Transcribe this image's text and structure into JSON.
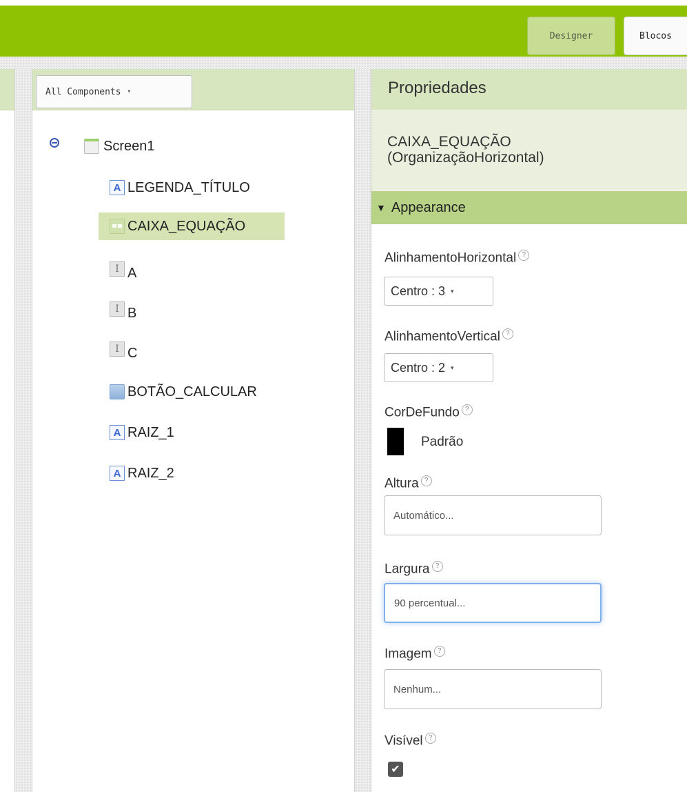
{
  "toolbar": {
    "designer_label": "Designer",
    "blocks_label": "Blocos"
  },
  "palette_dropdown": {
    "label": "All Components",
    "arrow": "▾"
  },
  "component_tree": {
    "root": "Screen1",
    "children": [
      {
        "label": "LEGENDA_TÍTULO",
        "icon": "label-icon",
        "glyph": "A"
      },
      {
        "label": "CAIXA_EQUAÇÃO",
        "icon": "horizontal-arrangement-icon",
        "glyph": "",
        "selected": true
      },
      {
        "label": "A",
        "icon": "textbox-icon",
        "glyph": "I"
      },
      {
        "label": "B",
        "icon": "textbox-icon",
        "glyph": "I"
      },
      {
        "label": "C",
        "icon": "textbox-icon",
        "glyph": "I"
      },
      {
        "label": "BOTÃO_CALCULAR",
        "icon": "button-icon",
        "glyph": ""
      },
      {
        "label": "RAIZ_1",
        "icon": "label-icon",
        "glyph": "A"
      },
      {
        "label": "RAIZ_2",
        "icon": "label-icon",
        "glyph": "A"
      }
    ]
  },
  "properties": {
    "header": "Propriedades",
    "component_name": "CAIXA_EQUAÇÃO",
    "component_type": "(OrganizaçãoHorizontal)",
    "section": "Appearance",
    "help_glyph": "?",
    "align_horizontal": {
      "label": "AlinhamentoHorizontal",
      "value": "Centro : 3",
      "arrow": "▾"
    },
    "align_vertical": {
      "label": "AlinhamentoVertical",
      "value": "Centro : 2",
      "arrow": "▾"
    },
    "background_color": {
      "label": "CorDeFundo",
      "value": "Padrão",
      "swatch": "#000000"
    },
    "height": {
      "label": "Altura",
      "value": "Automático..."
    },
    "width": {
      "label": "Largura",
      "value": "90 percentual..."
    },
    "image": {
      "label": "Imagem",
      "value": "Nenhum..."
    },
    "visible": {
      "label": "Visível",
      "checked": true,
      "glyph": "✔"
    }
  },
  "colors": {
    "topbar": "#8fc202",
    "panel_header": "#d8e6bf",
    "section_header": "#b8d286",
    "selected_row": "#d6e4b3"
  }
}
